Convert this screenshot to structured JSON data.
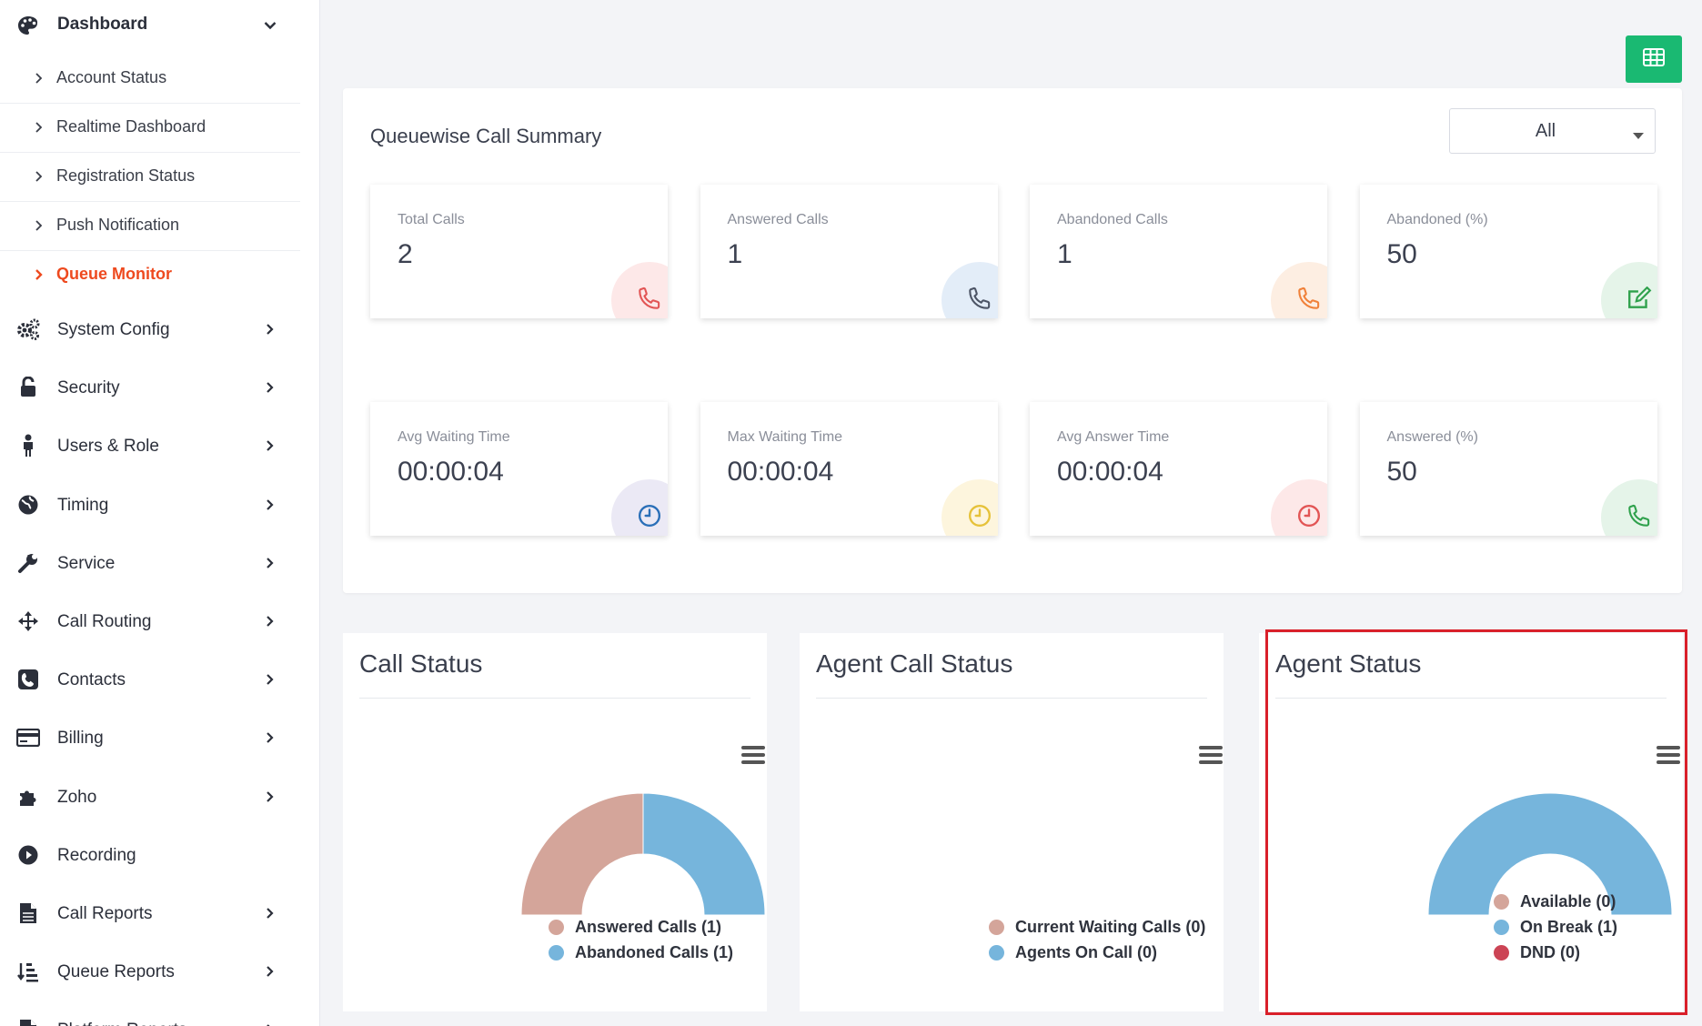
{
  "sidebar": {
    "dashboard_label": "Dashboard",
    "sub_items": [
      {
        "label": "Account Status"
      },
      {
        "label": "Realtime Dashboard"
      },
      {
        "label": "Registration Status"
      },
      {
        "label": "Push Notification"
      },
      {
        "label": "Queue Monitor",
        "active": true
      }
    ],
    "items": [
      {
        "label": "System Config",
        "icon": "gears-icon"
      },
      {
        "label": "Security",
        "icon": "unlock-icon"
      },
      {
        "label": "Users & Role",
        "icon": "user-icon"
      },
      {
        "label": "Timing",
        "icon": "globe-icon"
      },
      {
        "label": "Service",
        "icon": "wrench-icon"
      },
      {
        "label": "Call Routing",
        "icon": "arrows-icon"
      },
      {
        "label": "Contacts",
        "icon": "phone-square-icon"
      },
      {
        "label": "Billing",
        "icon": "credit-card-icon"
      },
      {
        "label": "Zoho",
        "icon": "puzzle-icon"
      },
      {
        "label": "Recording",
        "icon": "play-circle-icon"
      },
      {
        "label": "Call Reports",
        "icon": "file-icon"
      },
      {
        "label": "Queue Reports",
        "icon": "list-icon"
      },
      {
        "label": "Platform Reports",
        "icon": "file-icon"
      }
    ]
  },
  "summary": {
    "title": "Queuewise Call Summary",
    "filter_value": "All",
    "export_icon": "table-icon",
    "stats": [
      {
        "label": "Total Calls",
        "value": "2",
        "icon": "phone-icon",
        "color": "#e25555",
        "bg": "#fde8e8"
      },
      {
        "label": "Answered Calls",
        "value": "1",
        "icon": "phone-icon",
        "color": "#4d5566",
        "bg": "#e3edf8"
      },
      {
        "label": "Abandoned Calls",
        "value": "1",
        "icon": "phone-icon",
        "color": "#f0813a",
        "bg": "#fdeee2"
      },
      {
        "label": "Abandoned (%)",
        "value": "50",
        "icon": "edit-icon",
        "color": "#2fa14c",
        "bg": "#e5f4e9"
      },
      {
        "label": "Avg Waiting Time",
        "value": "00:00:04",
        "icon": "clock-icon",
        "color": "#2a6fb8",
        "bg": "#ebe9f5"
      },
      {
        "label": "Max Waiting Time",
        "value": "00:00:04",
        "icon": "clock-icon",
        "color": "#e6c23a",
        "bg": "#fdf5dd"
      },
      {
        "label": "Avg Answer Time",
        "value": "00:00:04",
        "icon": "clock-icon",
        "color": "#e25555",
        "bg": "#fde8e8"
      },
      {
        "label": "Answered (%)",
        "value": "50",
        "icon": "phone-icon",
        "color": "#2fa14c",
        "bg": "#e5f4e9"
      }
    ]
  },
  "charts": {
    "call_status": {
      "title": "Call Status",
      "legend": [
        "Answered Calls (1)",
        "Abandoned Calls (1)"
      ]
    },
    "agent_call_status": {
      "title": "Agent Call Status",
      "legend": [
        "Current Waiting Calls (0)",
        "Agents On Call (0)"
      ]
    },
    "agent_status": {
      "title": "Agent Status",
      "legend": [
        "Available (0)",
        "On Break (1)",
        "DND (0)"
      ]
    }
  },
  "chart_data": [
    {
      "type": "pie",
      "variant": "semi-donut",
      "title": "Call Status",
      "categories": [
        "Answered Calls",
        "Abandoned Calls"
      ],
      "values": [
        1,
        1
      ],
      "colors": [
        "#d4a59a",
        "#76b5dc"
      ],
      "legend": "bottom"
    },
    {
      "type": "pie",
      "variant": "semi-donut",
      "title": "Agent Call Status",
      "categories": [
        "Current Waiting Calls",
        "Agents On Call"
      ],
      "values": [
        0,
        0
      ],
      "colors": [
        "#d4a59a",
        "#76b5dc"
      ],
      "legend": "bottom"
    },
    {
      "type": "pie",
      "variant": "semi-donut",
      "title": "Agent Status",
      "categories": [
        "Available",
        "On Break",
        "DND"
      ],
      "values": [
        0,
        1,
        0
      ],
      "colors": [
        "#d4a59a",
        "#76b5dc",
        "#cc4455"
      ],
      "legend": "bottom"
    }
  ],
  "colors": {
    "accent": "#ee4a1f",
    "export_button": "#1ab972",
    "highlight_border": "#d9202a"
  }
}
